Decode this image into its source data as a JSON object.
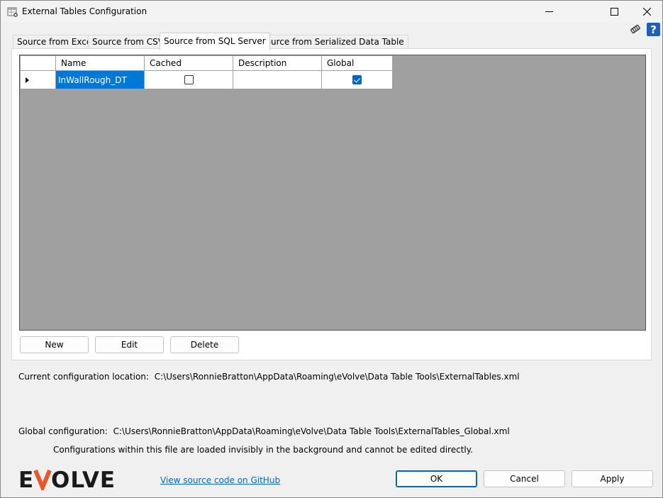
{
  "window": {
    "title": "External Tables Configuration"
  },
  "tabs": [
    {
      "label": "Source from Excel",
      "active": false
    },
    {
      "label": "Source from CSV",
      "active": false
    },
    {
      "label": "Source from SQL Server",
      "active": true
    },
    {
      "label": "Source from Serialized Data Table",
      "active": false
    }
  ],
  "grid": {
    "columns": [
      "Name",
      "Cached",
      "Description",
      "Global"
    ],
    "rows": [
      {
        "name": "InWallRough_DT",
        "cached": false,
        "description": "",
        "global": true
      }
    ]
  },
  "actions": {
    "new_label": "New",
    "edit_label": "Edit",
    "delete_label": "Delete"
  },
  "config": {
    "current_label": "Current  configuration  location:",
    "current_path": "C:\\Users\\RonnieBratton\\AppData\\Roaming\\eVolve\\Data Table Tools\\ExternalTables.xml",
    "global_label": "Global  configuration:",
    "global_path": "C:\\Users\\RonnieBratton\\AppData\\Roaming\\eVolve\\Data Table Tools\\ExternalTables_Global.xml",
    "global_note": "Configurations within this file are loaded invisibly in the background and cannot be edited directly."
  },
  "footer": {
    "logo_text": "EVOLVE",
    "github_link": "View source code on GitHub",
    "ok_label": "OK",
    "cancel_label": "Cancel",
    "apply_label": "Apply"
  },
  "colors": {
    "accent": "#0078d7",
    "logo_accent": "#e8562a",
    "help_blue": "#1f5fb4"
  },
  "icons": [
    "app-icon",
    "minimize-icon",
    "maximize-icon",
    "close-icon",
    "settings-icon",
    "help-icon",
    "row-selector-icon"
  ]
}
